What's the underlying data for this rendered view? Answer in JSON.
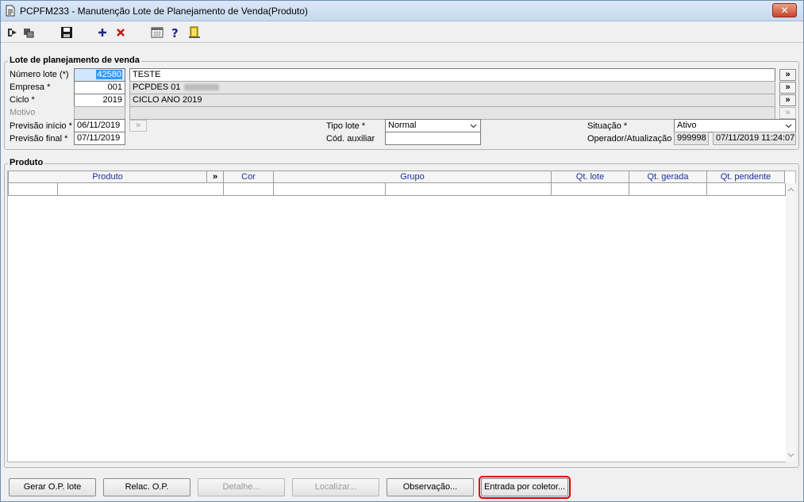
{
  "window": {
    "title": "PCPFM233 - Manutenção Lote de Planejamento de Venda(Produto)",
    "close_label": "✕"
  },
  "toolbar": {
    "items": [
      "first-record",
      "last-record",
      "save",
      "add",
      "delete",
      "calendar",
      "help",
      "exit"
    ]
  },
  "lote": {
    "group_label": "Lote de planejamento de venda",
    "numero_lote": {
      "label": "Número lote (*)",
      "value": "42580",
      "desc": "TESTE"
    },
    "empresa": {
      "label": "Empresa *",
      "value": "001",
      "desc": "PCPDES 01"
    },
    "ciclo": {
      "label": "Ciclo *",
      "value": "2019",
      "desc": "CICLO ANO 2019"
    },
    "motivo": {
      "label": "Motivo",
      "value": "",
      "desc": ""
    },
    "previsao_inicio": {
      "label": "Previsão início *",
      "value": "06/11/2019"
    },
    "previsao_final": {
      "label": "Previsão final *",
      "value": "07/11/2019"
    },
    "tipo_lote": {
      "label": "Tipo lote *",
      "value": "Normal"
    },
    "cod_auxiliar": {
      "label": "Cód. auxiliar",
      "value": ""
    },
    "situacao": {
      "label": "Situação *",
      "value": "Ativo"
    },
    "operador": {
      "label": "Operador/Atualização",
      "value": "999998",
      "timestamp": "07/11/2019 11:24:07"
    },
    "lookup_label": "»"
  },
  "produto": {
    "group_label": "Produto",
    "columns": [
      "Produto",
      "»",
      "Cor",
      "Grupo",
      "Qt. lote",
      "Qt. gerada",
      "Qt. pendente"
    ]
  },
  "buttons": {
    "gerar": "Gerar O.P. lote",
    "relac": "Relac. O.P.",
    "detalhe": "Detalhe...",
    "localizar": "Localizar...",
    "observacao": "Observação...",
    "entrada": "Entrada por coletor..."
  }
}
